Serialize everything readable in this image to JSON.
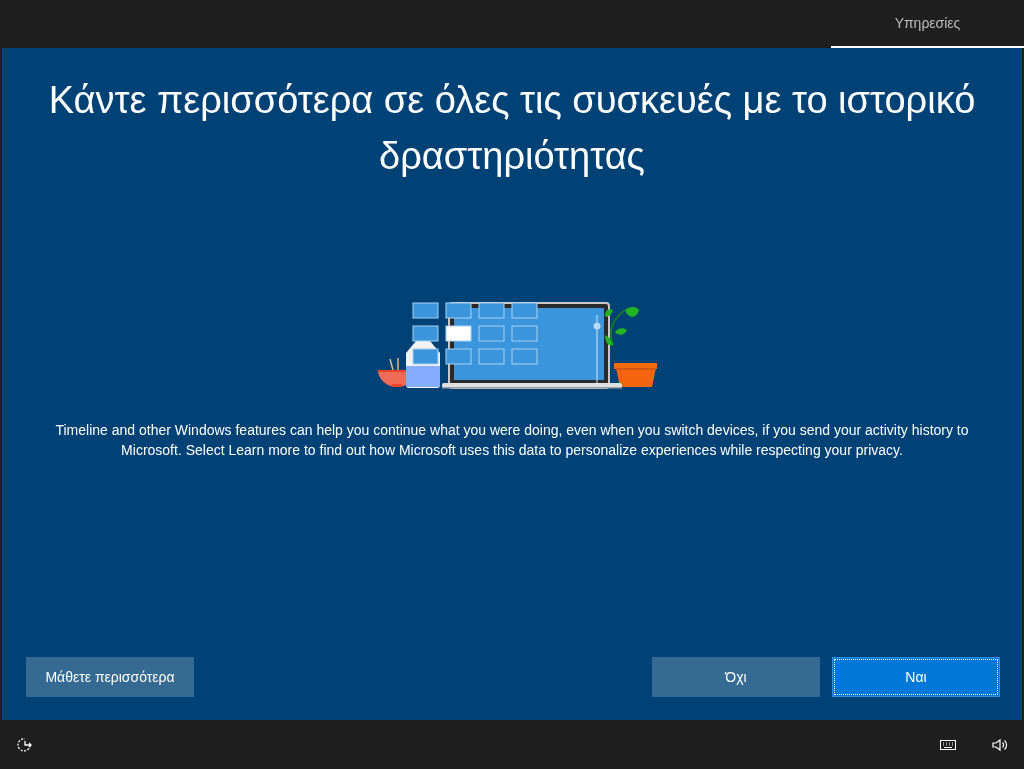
{
  "tabs": [
    {
      "label": "Υπηρεσίες",
      "selected": true
    }
  ],
  "title": "Κάντε περισσότερα σε όλες τις συσκευές με το ιστορικό δραστηριότητας",
  "description": "Timeline and other Windows features can help you continue what you were doing, even when you switch devices, if you send your activity history to Microsoft. Select Learn more to find out how Microsoft uses this data to personalize experiences while respecting your privacy.",
  "left_buttons": [
    {
      "label": "Μάθετε περισσότερα",
      "kind": "secondary"
    }
  ],
  "right_buttons": [
    {
      "label": "Όχι",
      "kind": "secondary"
    },
    {
      "label": "Ναι",
      "kind": "primary"
    }
  ]
}
